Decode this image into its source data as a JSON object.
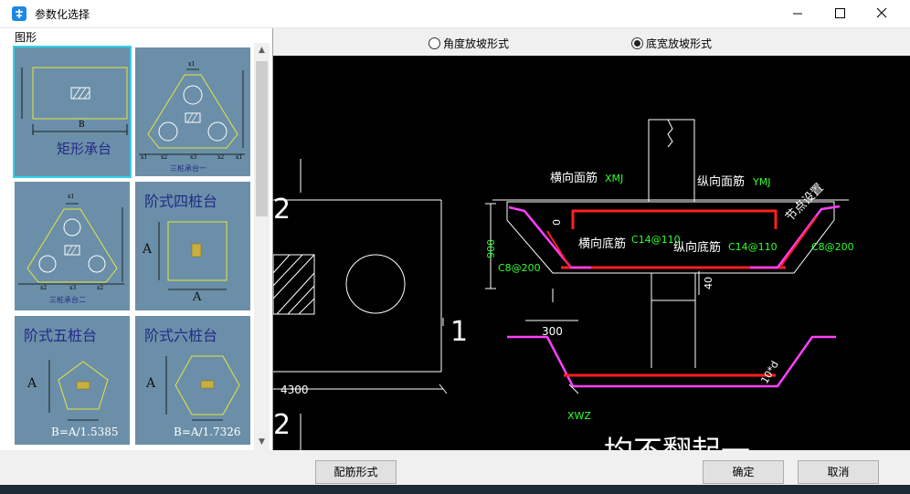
{
  "window": {
    "title": "参数化选择",
    "accent": "#1e88e5"
  },
  "left_panel": {
    "group_label": "图形",
    "items": [
      {
        "label": "矩形承台",
        "selected": true,
        "dim": "B"
      },
      {
        "label": "三桩承台一",
        "selected": false,
        "dims": [
          "x1",
          "x2",
          "x3",
          "x2",
          "x1",
          "y1",
          "y2",
          "y2",
          "y1"
        ]
      },
      {
        "label": "三桩承台二",
        "selected": false,
        "dims": [
          "x1",
          "x2",
          "x3",
          "x2",
          "x1",
          "y1",
          "y2",
          "y3"
        ]
      },
      {
        "label": "阶式四桩台",
        "selected": false,
        "dim": "A"
      },
      {
        "label": "阶式五桩台",
        "selected": false,
        "formula": "B=A/1.5385",
        "dim": "A"
      },
      {
        "label": "阶式六桩台",
        "selected": false,
        "formula": "B=A/1.7326",
        "dim": "A"
      }
    ]
  },
  "right_panel": {
    "options": [
      {
        "label": "角度放坡形式",
        "checked": false
      },
      {
        "label": "底宽放坡形式",
        "checked": true
      }
    ],
    "preview": {
      "section_marks": [
        "2",
        "1",
        "2"
      ],
      "dim_4300": "4300",
      "labels": {
        "horiz_top_bar": "横向面筋",
        "horiz_top_bar_code": "XMJ",
        "vert_top_bar": "纵向面筋",
        "vert_top_bar_code": "YMJ",
        "node_setting": "节点设置",
        "horiz_bottom_bar": "横向底筋",
        "horiz_bottom_bar_spec": "C14@110",
        "vert_bottom_bar": "纵向底筋",
        "vert_bottom_bar_spec": "C14@110",
        "stirrup_right": "C8@200",
        "stirrup_left": "C8@200",
        "dim_900": "900",
        "dim_0": "0",
        "dim_40": "40",
        "dim_300": "300",
        "xwz": "XWZ",
        "anchor": "10*d",
        "note": "均不翻起一"
      },
      "colors": {
        "background": "#000000",
        "line": "#ffffff",
        "rebar": "#ff2020",
        "slope": "#ff40ff",
        "dimension": "#30ff30"
      }
    }
  },
  "buttons": {
    "rebar_form": "配筋形式",
    "ok": "确定",
    "cancel": "取消"
  }
}
